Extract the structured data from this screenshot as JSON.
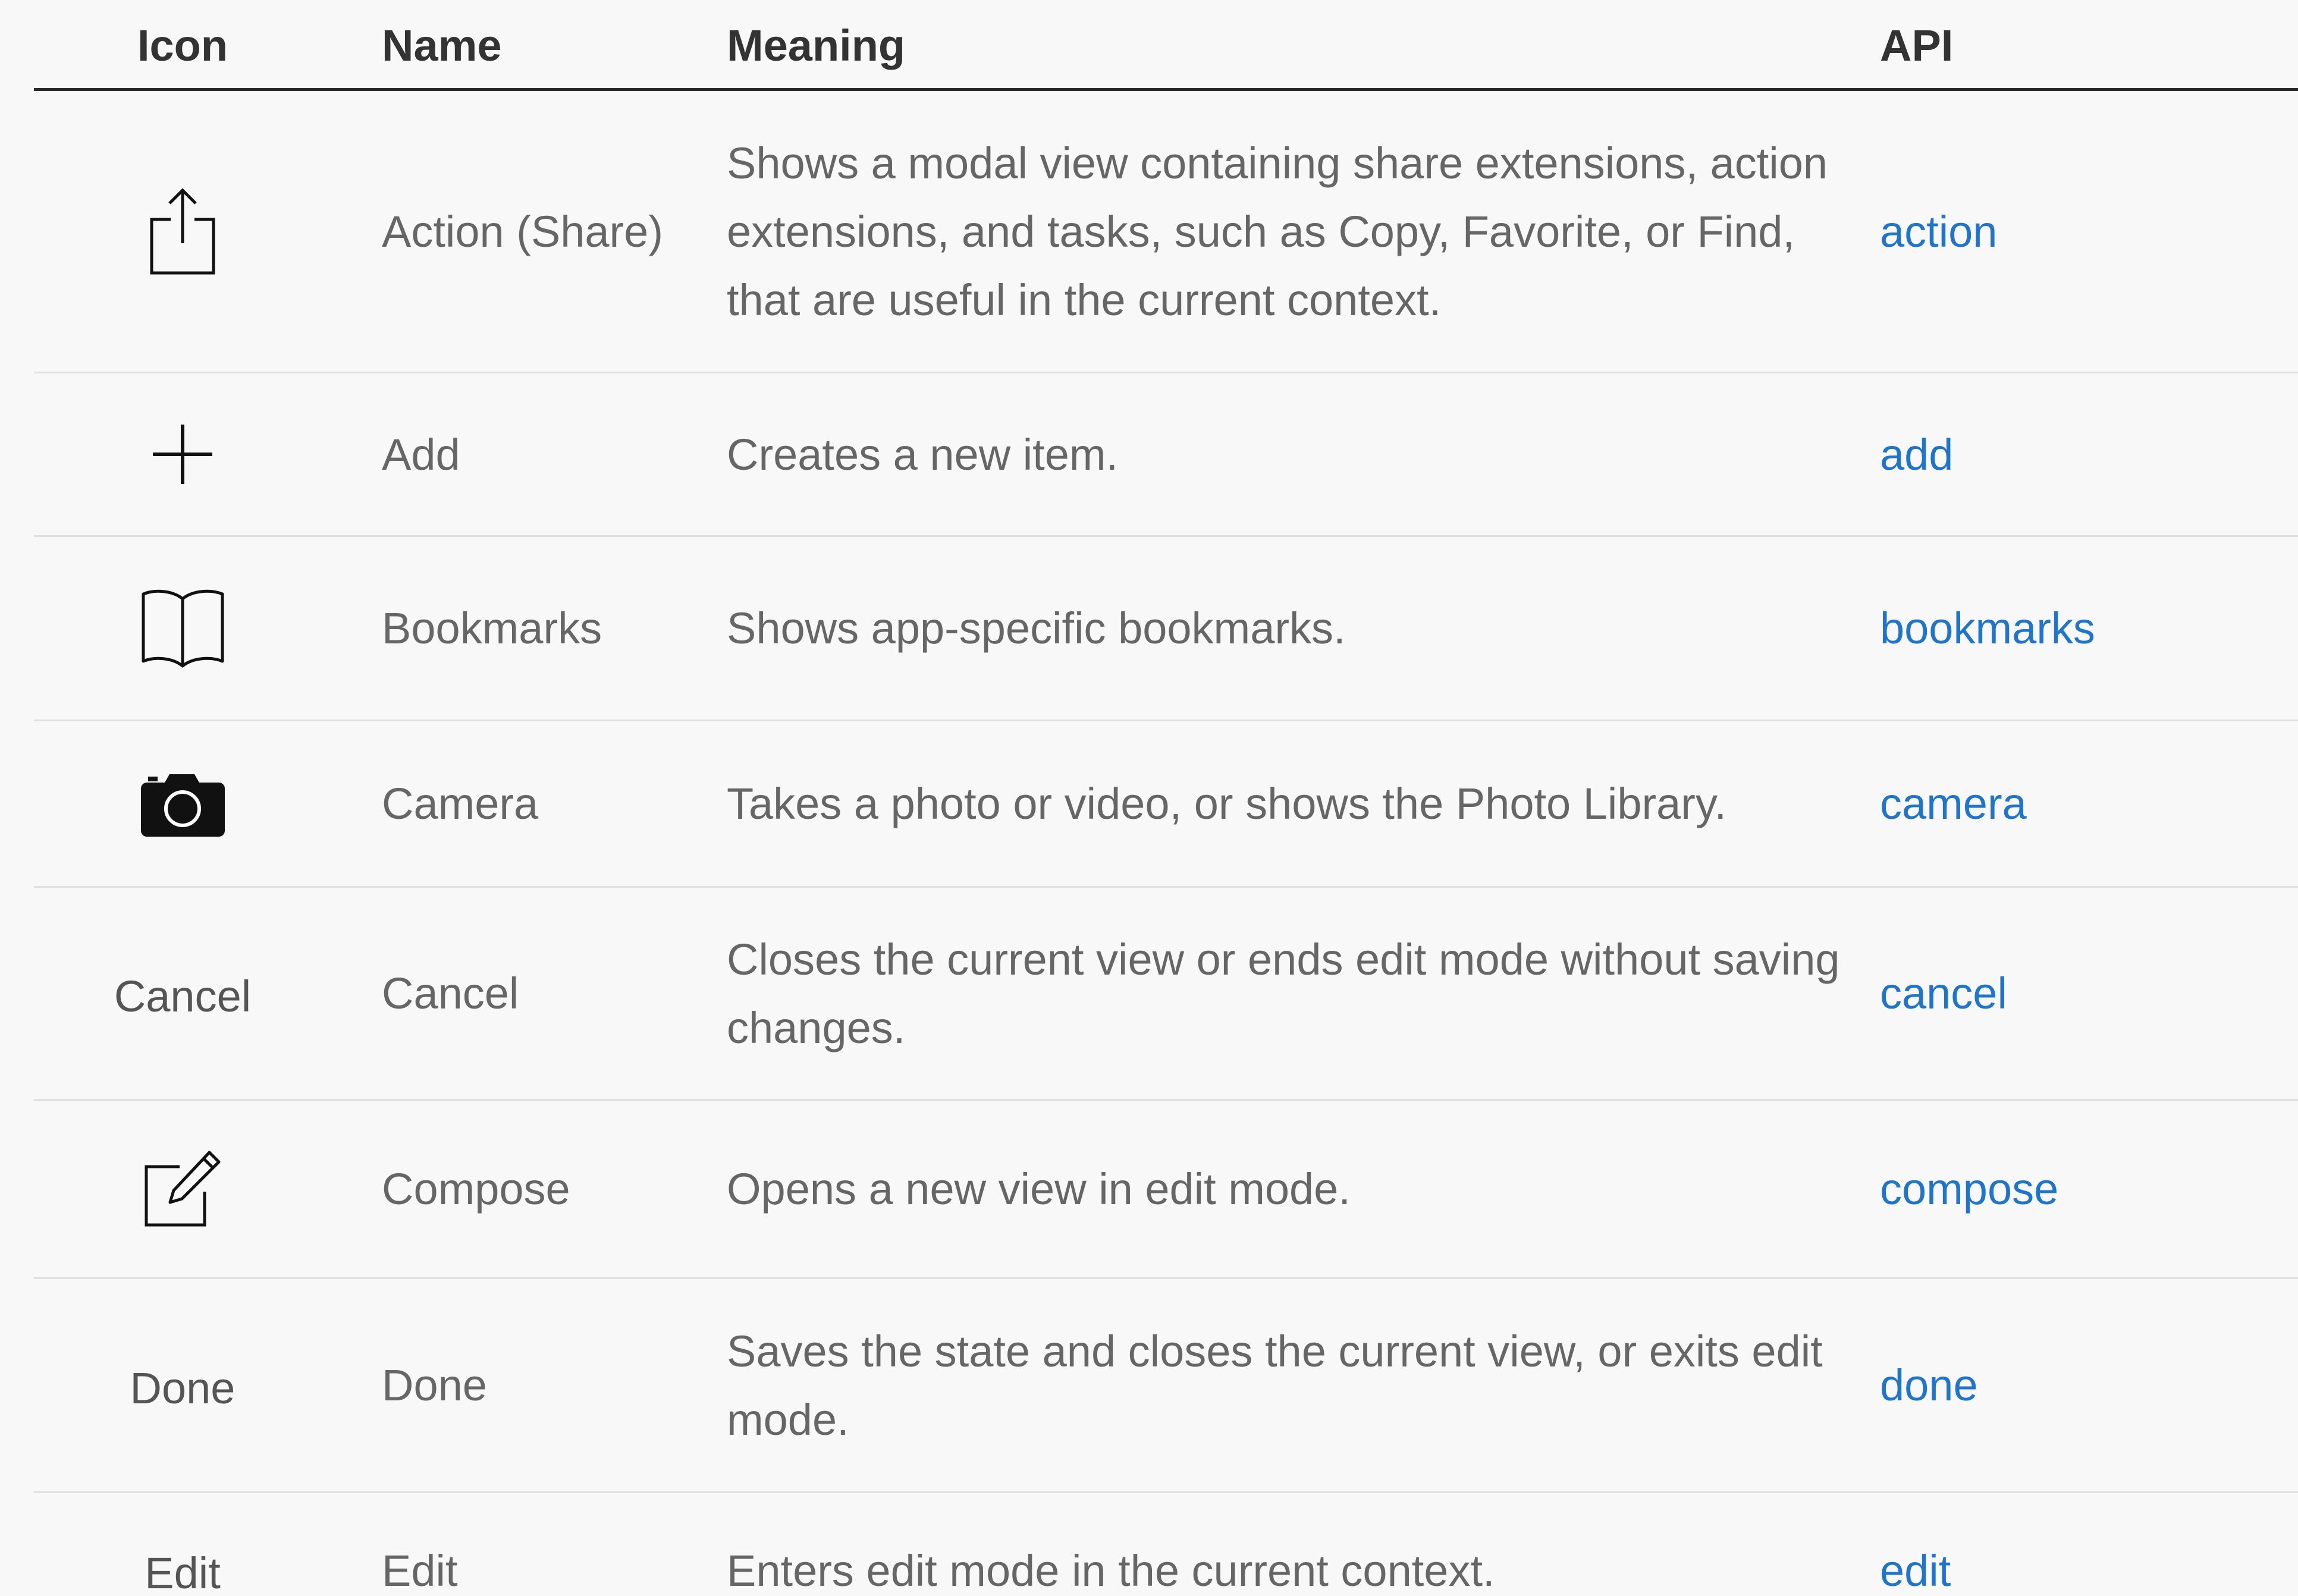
{
  "headers": {
    "icon": "Icon",
    "name": "Name",
    "meaning": "Meaning",
    "api": "API"
  },
  "rows": [
    {
      "icon": "share-icon",
      "name": "Action (Share)",
      "meaning": "Shows a modal view containing share extensions, action extensions, and tasks, such as Copy, Favorite, or Find, that are useful in the current context.",
      "api": "action"
    },
    {
      "icon": "plus-icon",
      "name": "Add",
      "meaning": "Creates a new item.",
      "api": "add"
    },
    {
      "icon": "book-icon",
      "name": "Bookmarks",
      "meaning": "Shows app-specific bookmarks.",
      "api": "bookmarks"
    },
    {
      "icon": "camera-icon",
      "name": "Camera",
      "meaning": "Takes a photo or video, or shows the Photo Library.",
      "api": "camera"
    },
    {
      "icon_text": "Cancel",
      "name": "Cancel",
      "meaning": "Closes the current view or ends edit mode without saving changes.",
      "api": "cancel"
    },
    {
      "icon": "compose-icon",
      "name": "Compose",
      "meaning": "Opens a new view in edit mode.",
      "api": "compose"
    },
    {
      "icon_text": "Done",
      "name": "Done",
      "meaning": "Saves the state and closes the current view, or exits edit mode.",
      "api": "done"
    },
    {
      "icon_text": "Edit",
      "name": "Edit",
      "meaning": "Enters edit mode in the current context.",
      "api": "edit"
    }
  ],
  "colors": {
    "link": "#1f74cc",
    "text": "#666666",
    "header": "#333333",
    "background": "#f8f8f8"
  }
}
